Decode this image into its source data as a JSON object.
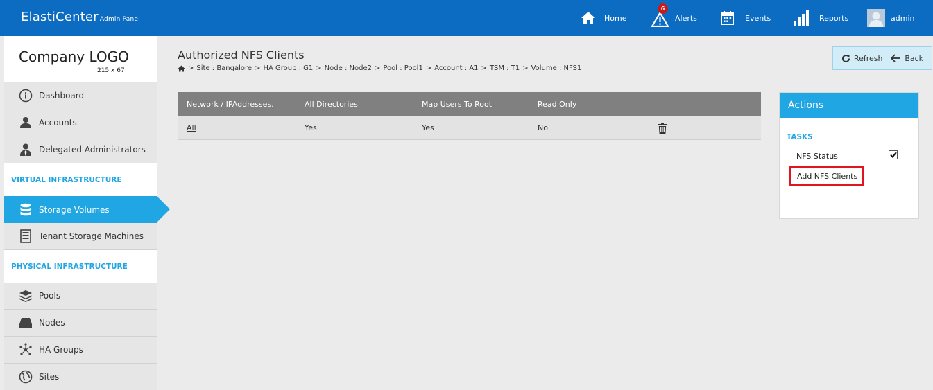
{
  "app": {
    "brand": "ElastiCenter",
    "brand_sub": "Admin Panel"
  },
  "topnav": {
    "home": "Home",
    "alerts": "Alerts",
    "alerts_badge": "6",
    "events": "Events",
    "reports": "Reports",
    "user": "admin"
  },
  "logo": {
    "title": "Company LOGO",
    "size": "215 x 67"
  },
  "sidebar": {
    "items_top": [
      {
        "label": "Dashboard",
        "icon": "info-icon"
      },
      {
        "label": "Accounts",
        "icon": "user-icon"
      },
      {
        "label": "Delegated Administrators",
        "icon": "admin-user-icon"
      }
    ],
    "section_virtual": "VIRTUAL INFRASTRUCTURE",
    "items_virtual": [
      {
        "label": "Storage Volumes",
        "icon": "database-icon",
        "active": true
      },
      {
        "label": "Tenant Storage Machines",
        "icon": "server-icon"
      }
    ],
    "section_physical": "PHYSICAL INFRASTRUCTURE",
    "items_physical": [
      {
        "label": "Pools",
        "icon": "layers-icon"
      },
      {
        "label": "Nodes",
        "icon": "drive-icon"
      },
      {
        "label": "HA Groups",
        "icon": "network-icon"
      },
      {
        "label": "Sites",
        "icon": "globe-icon"
      }
    ]
  },
  "page": {
    "title": "Authorized NFS Clients",
    "breadcrumb": [
      "Site : Bangalore",
      "HA Group : G1",
      "Node : Node2",
      "Pool : Pool1",
      "Account : A1",
      "TSM : T1",
      "Volume : NFS1"
    ],
    "breadcrumb_sep": ">"
  },
  "toolbar": {
    "refresh": "Refresh",
    "back": "Back"
  },
  "table": {
    "headers": [
      "Network / IPAddresses.",
      "All Directories",
      "Map Users To Root",
      "Read Only"
    ],
    "rows": [
      {
        "network": "All",
        "all_directories": "Yes",
        "map_users_to_root": "Yes",
        "read_only": "No"
      }
    ]
  },
  "actions": {
    "title": "Actions",
    "tasks_label": "TASKS",
    "nfs_status": "NFS Status",
    "nfs_status_checked": true,
    "add_nfs_clients": "Add NFS Clients"
  },
  "colors": {
    "topbar": "#0b6cc2",
    "accent": "#1fa6e3",
    "highlight": "#e0151f",
    "table_header": "#808080"
  }
}
